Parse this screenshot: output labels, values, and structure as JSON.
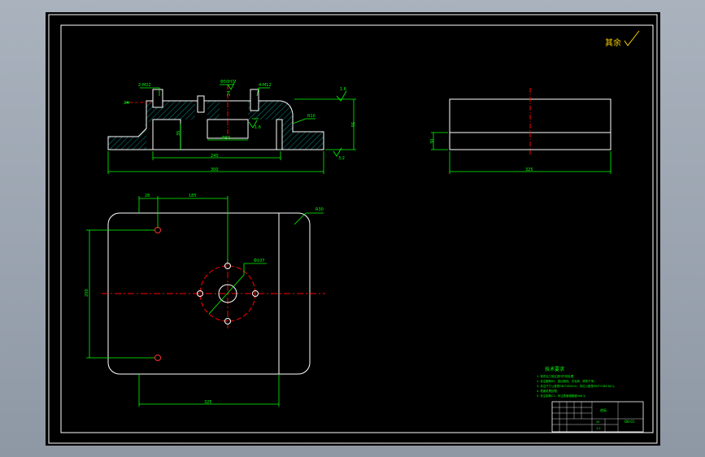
{
  "drawing": {
    "roughness_note": "其余",
    "section_view": {
      "dims": {
        "hole_left": "2-M22",
        "bore_top": "Φ50H7",
        "hole_right": "4-M12",
        "left_small": "24",
        "center_small": "24",
        "step_height": "35",
        "bore_dia": "Φ50",
        "roughness_mid": "1.6",
        "chamfer": "R10",
        "roughness_top": "1.6",
        "height_right": "50",
        "inner_width": "240",
        "overall_width": "300",
        "roughness_bottom": "3.2"
      }
    },
    "side_view": {
      "dims": {
        "thickness": "30",
        "width": "325"
      }
    },
    "plan_view": {
      "dims": {
        "hole_offset": "28",
        "to_center": "185",
        "corner_radius": "R30",
        "bolt_circle": "Φ107",
        "hole_span": "200",
        "base_length": "325"
      }
    },
    "tech_notes": {
      "title": "技术要求",
      "lines": [
        "1. 零件加工前应进行时效处理。",
        "2. 未注圆角R2，锐边倒钝，去毛刺，清洗干净。",
        "3. 未注尺寸公差按GB/T1804-m，形位公差按GB/T1184-K(C)。",
        "4. 表面发黑处理。",
        "5. 未注倒角C1，未注表面粗糙度Ra6.3。"
      ]
    },
    "title_block": {
      "part_name": "底板",
      "drawing_no": "DB-01",
      "material": "45",
      "scale": "1:2"
    }
  }
}
